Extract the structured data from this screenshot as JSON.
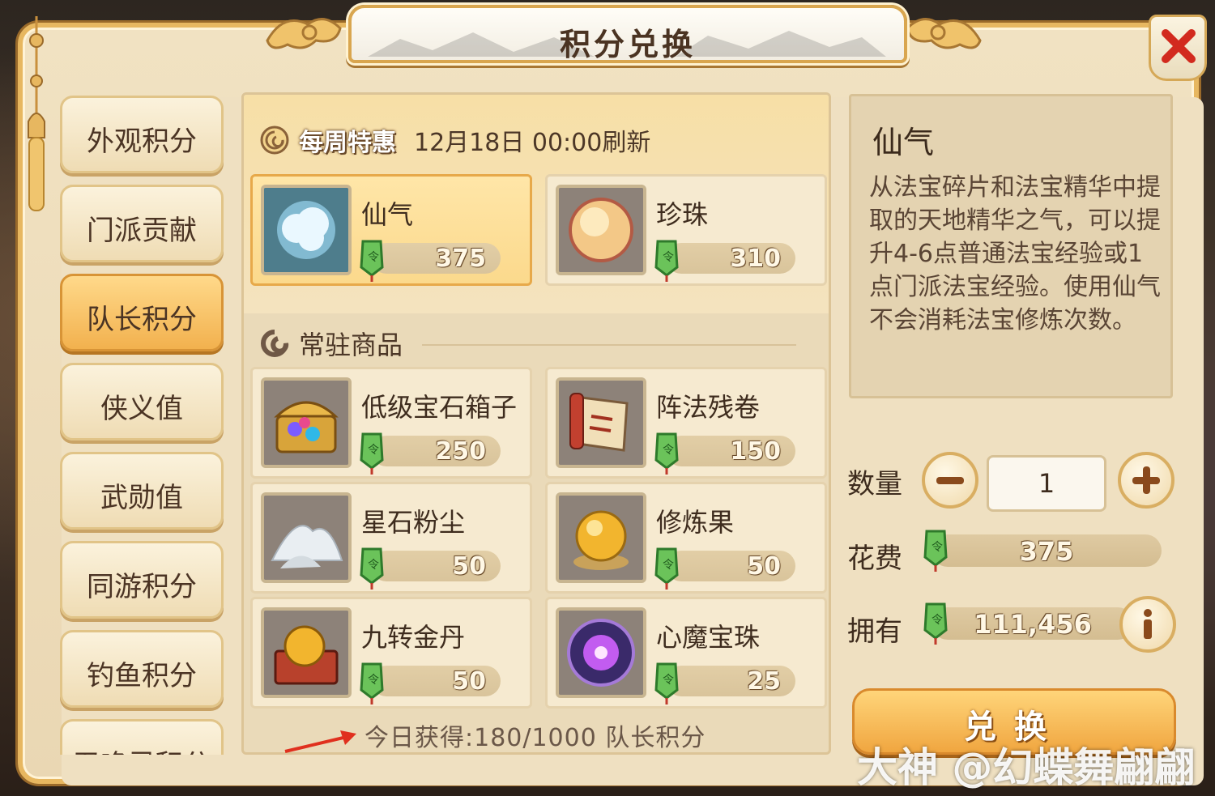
{
  "window": {
    "title": "积分兑换"
  },
  "tabs": [
    {
      "label": "外观积分"
    },
    {
      "label": "门派贡献"
    },
    {
      "label": "队长积分",
      "active": true
    },
    {
      "label": "侠义值"
    },
    {
      "label": "武勋值"
    },
    {
      "label": "同游积分"
    },
    {
      "label": "钓鱼积分"
    },
    {
      "label": "召唤灵积分"
    }
  ],
  "weekly": {
    "badge": "每周特惠",
    "refresh": "12月18日  00:00刷新",
    "items": [
      {
        "name": "仙气",
        "price": "375",
        "icon": "cloud-essence-icon",
        "selected": true
      },
      {
        "name": "珍珠",
        "price": "310",
        "icon": "pearl-icon"
      }
    ]
  },
  "regular": {
    "title": "常驻商品",
    "items": [
      {
        "name": "低级宝石箱子",
        "price": "250",
        "icon": "gem-chest-icon"
      },
      {
        "name": "阵法残卷",
        "price": "150",
        "icon": "scroll-icon"
      },
      {
        "name": "星石粉尘",
        "price": "50",
        "icon": "star-dust-icon"
      },
      {
        "name": "修炼果",
        "price": "50",
        "icon": "golden-fruit-icon"
      },
      {
        "name": "九转金丹",
        "price": "50",
        "icon": "golden-pill-box-icon"
      },
      {
        "name": "心魔宝珠",
        "price": "25",
        "icon": "purple-orb-icon"
      }
    ]
  },
  "today": "今日获得:180/1000 队长积分",
  "detail": {
    "name": "仙气",
    "desc": "从法宝碎片和法宝精华中提取的天地精华之气，可以提升4-6点普通法宝经验或1点门派法宝经验。使用仙气不会消耗法宝修炼次数。"
  },
  "purchase": {
    "qty_label": "数量",
    "qty": "1",
    "cost_label": "花费",
    "cost": "375",
    "own_label": "拥有",
    "own": "111,456",
    "exchange_label": "兑换"
  },
  "watermark": "大神 @幻蝶舞翩翩",
  "colors": {
    "accent": "#f0a640",
    "frame": "#e7b760",
    "close": "#d22a1e"
  }
}
